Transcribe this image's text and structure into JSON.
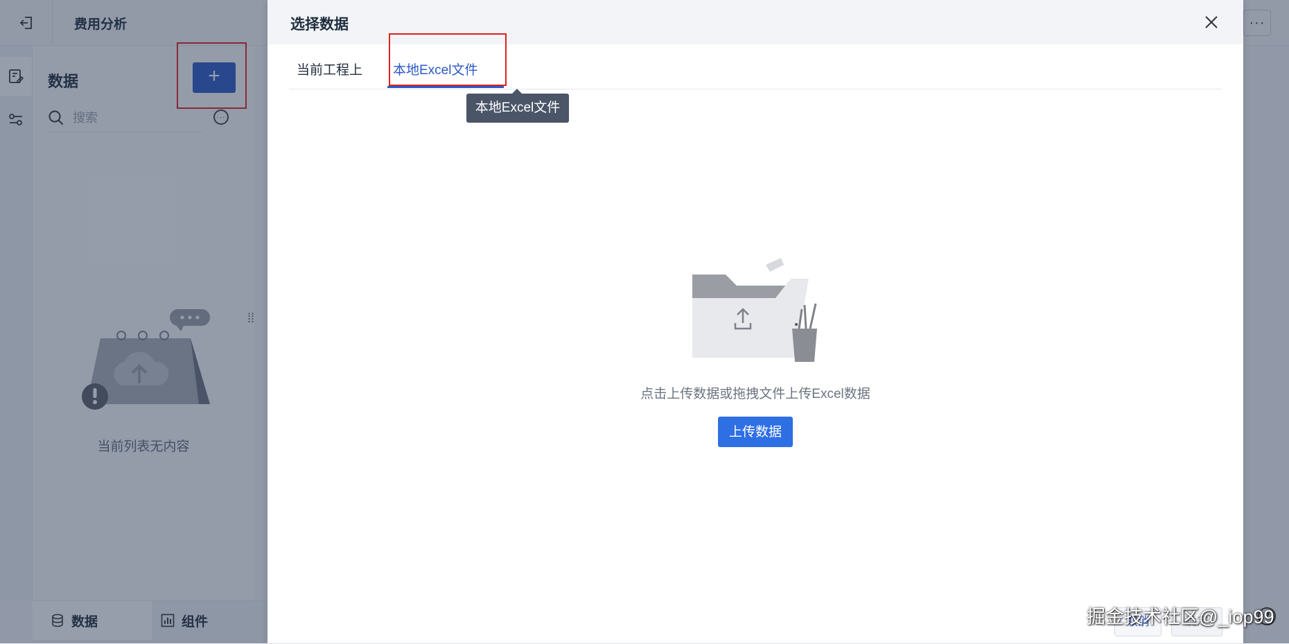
{
  "app": {
    "title": "费用分析",
    "more_icon": "···"
  },
  "left_panel": {
    "title": "数据",
    "add_label": "+",
    "search": {
      "placeholder": "搜索"
    },
    "more_icon": "···",
    "empty_text": "当前列表无内容"
  },
  "bottom_tabs": [
    {
      "label": "数据",
      "icon": "database-icon",
      "active": true
    },
    {
      "label": "组件",
      "icon": "chart-icon",
      "active": false
    }
  ],
  "modal": {
    "title": "选择数据",
    "tabs": [
      {
        "label": "当前工程上",
        "active": false
      },
      {
        "label": "本地Excel文件",
        "active": true
      }
    ],
    "tooltip": "本地Excel文件",
    "upload_hint": "点击上传数据或拖拽文件上传Excel数据",
    "upload_button": "上传数据",
    "footer": {
      "cancel": "取消",
      "confirm": "确定"
    }
  },
  "watermark": "掘金技术社区@_iop99",
  "help_icon": "?",
  "colors": {
    "primary": "#2b59c3",
    "upload_button": "#2f6fe4",
    "annotation_red": "#e0201f",
    "tooltip_bg": "#4a5568"
  }
}
